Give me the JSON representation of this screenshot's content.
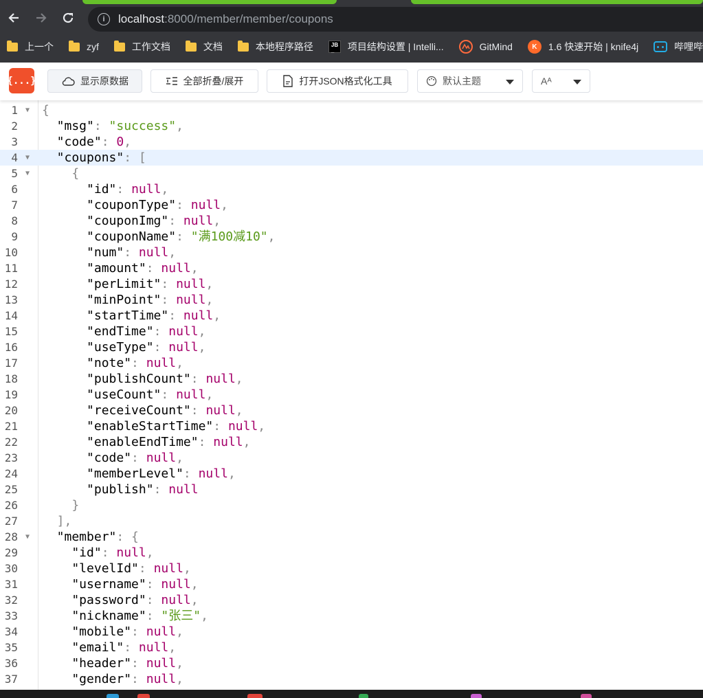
{
  "browser": {
    "url_host": "localhost",
    "url_path": ":8000/member/member/coupons",
    "bookmarks": [
      {
        "label": "上一个",
        "icon": "folder-icon"
      },
      {
        "label": "zyf",
        "icon": "folder-icon"
      },
      {
        "label": "工作文档",
        "icon": "folder-icon"
      },
      {
        "label": "文档",
        "icon": "folder-icon"
      },
      {
        "label": "本地程序路径",
        "icon": "folder-icon"
      },
      {
        "label": "项目结构设置 | Intelli...",
        "icon": "jetbrains-icon"
      },
      {
        "label": "GitMind",
        "icon": "gitmind-icon"
      },
      {
        "label": "1.6 快速开始 | knife4j",
        "icon": "knife4j-icon"
      },
      {
        "label": "哔哩哔",
        "icon": "bilibili-icon"
      }
    ]
  },
  "toolbar": {
    "logo_text": "{...}",
    "raw_label": "显示原数据",
    "fold_label": "全部折叠/展开",
    "format_label": "打开JSON格式化工具",
    "theme_label": "默认主题",
    "font_label": "Aᴬ"
  },
  "code_lines": [
    [
      [
        "p",
        "{"
      ]
    ],
    [
      [
        "k",
        "  \"msg\""
      ],
      [
        "p",
        ": "
      ],
      [
        "s",
        "\"success\""
      ],
      [
        "p",
        ","
      ]
    ],
    [
      [
        "k",
        "  \"code\""
      ],
      [
        "p",
        ": "
      ],
      [
        "n",
        "0"
      ],
      [
        "p",
        ","
      ]
    ],
    [
      [
        "k",
        "  \"coupons\""
      ],
      [
        "p",
        ": ["
      ]
    ],
    [
      [
        "p",
        "    {"
      ]
    ],
    [
      [
        "k",
        "      \"id\""
      ],
      [
        "p",
        ": "
      ],
      [
        "n",
        "null"
      ],
      [
        "p",
        ","
      ]
    ],
    [
      [
        "k",
        "      \"couponType\""
      ],
      [
        "p",
        ": "
      ],
      [
        "n",
        "null"
      ],
      [
        "p",
        ","
      ]
    ],
    [
      [
        "k",
        "      \"couponImg\""
      ],
      [
        "p",
        ": "
      ],
      [
        "n",
        "null"
      ],
      [
        "p",
        ","
      ]
    ],
    [
      [
        "k",
        "      \"couponName\""
      ],
      [
        "p",
        ": "
      ],
      [
        "s",
        "\"满100减10\""
      ],
      [
        "p",
        ","
      ]
    ],
    [
      [
        "k",
        "      \"num\""
      ],
      [
        "p",
        ": "
      ],
      [
        "n",
        "null"
      ],
      [
        "p",
        ","
      ]
    ],
    [
      [
        "k",
        "      \"amount\""
      ],
      [
        "p",
        ": "
      ],
      [
        "n",
        "null"
      ],
      [
        "p",
        ","
      ]
    ],
    [
      [
        "k",
        "      \"perLimit\""
      ],
      [
        "p",
        ": "
      ],
      [
        "n",
        "null"
      ],
      [
        "p",
        ","
      ]
    ],
    [
      [
        "k",
        "      \"minPoint\""
      ],
      [
        "p",
        ": "
      ],
      [
        "n",
        "null"
      ],
      [
        "p",
        ","
      ]
    ],
    [
      [
        "k",
        "      \"startTime\""
      ],
      [
        "p",
        ": "
      ],
      [
        "n",
        "null"
      ],
      [
        "p",
        ","
      ]
    ],
    [
      [
        "k",
        "      \"endTime\""
      ],
      [
        "p",
        ": "
      ],
      [
        "n",
        "null"
      ],
      [
        "p",
        ","
      ]
    ],
    [
      [
        "k",
        "      \"useType\""
      ],
      [
        "p",
        ": "
      ],
      [
        "n",
        "null"
      ],
      [
        "p",
        ","
      ]
    ],
    [
      [
        "k",
        "      \"note\""
      ],
      [
        "p",
        ": "
      ],
      [
        "n",
        "null"
      ],
      [
        "p",
        ","
      ]
    ],
    [
      [
        "k",
        "      \"publishCount\""
      ],
      [
        "p",
        ": "
      ],
      [
        "n",
        "null"
      ],
      [
        "p",
        ","
      ]
    ],
    [
      [
        "k",
        "      \"useCount\""
      ],
      [
        "p",
        ": "
      ],
      [
        "n",
        "null"
      ],
      [
        "p",
        ","
      ]
    ],
    [
      [
        "k",
        "      \"receiveCount\""
      ],
      [
        "p",
        ": "
      ],
      [
        "n",
        "null"
      ],
      [
        "p",
        ","
      ]
    ],
    [
      [
        "k",
        "      \"enableStartTime\""
      ],
      [
        "p",
        ": "
      ],
      [
        "n",
        "null"
      ],
      [
        "p",
        ","
      ]
    ],
    [
      [
        "k",
        "      \"enableEndTime\""
      ],
      [
        "p",
        ": "
      ],
      [
        "n",
        "null"
      ],
      [
        "p",
        ","
      ]
    ],
    [
      [
        "k",
        "      \"code\""
      ],
      [
        "p",
        ": "
      ],
      [
        "n",
        "null"
      ],
      [
        "p",
        ","
      ]
    ],
    [
      [
        "k",
        "      \"memberLevel\""
      ],
      [
        "p",
        ": "
      ],
      [
        "n",
        "null"
      ],
      [
        "p",
        ","
      ]
    ],
    [
      [
        "k",
        "      \"publish\""
      ],
      [
        "p",
        ": "
      ],
      [
        "n",
        "null"
      ]
    ],
    [
      [
        "p",
        "    }"
      ]
    ],
    [
      [
        "p",
        "  ],"
      ]
    ],
    [
      [
        "k",
        "  \"member\""
      ],
      [
        "p",
        ": {"
      ]
    ],
    [
      [
        "k",
        "    \"id\""
      ],
      [
        "p",
        ": "
      ],
      [
        "n",
        "null"
      ],
      [
        "p",
        ","
      ]
    ],
    [
      [
        "k",
        "    \"levelId\""
      ],
      [
        "p",
        ": "
      ],
      [
        "n",
        "null"
      ],
      [
        "p",
        ","
      ]
    ],
    [
      [
        "k",
        "    \"username\""
      ],
      [
        "p",
        ": "
      ],
      [
        "n",
        "null"
      ],
      [
        "p",
        ","
      ]
    ],
    [
      [
        "k",
        "    \"password\""
      ],
      [
        "p",
        ": "
      ],
      [
        "n",
        "null"
      ],
      [
        "p",
        ","
      ]
    ],
    [
      [
        "k",
        "    \"nickname\""
      ],
      [
        "p",
        ": "
      ],
      [
        "s",
        "\"张三\""
      ],
      [
        "p",
        ","
      ]
    ],
    [
      [
        "k",
        "    \"mobile\""
      ],
      [
        "p",
        ": "
      ],
      [
        "n",
        "null"
      ],
      [
        "p",
        ","
      ]
    ],
    [
      [
        "k",
        "    \"email\""
      ],
      [
        "p",
        ": "
      ],
      [
        "n",
        "null"
      ],
      [
        "p",
        ","
      ]
    ],
    [
      [
        "k",
        "    \"header\""
      ],
      [
        "p",
        ": "
      ],
      [
        "n",
        "null"
      ],
      [
        "p",
        ","
      ]
    ],
    [
      [
        "k",
        "    \"gender\""
      ],
      [
        "p",
        ": "
      ],
      [
        "n",
        "null"
      ],
      [
        "p",
        ","
      ]
    ]
  ],
  "fold_lines": [
    1,
    4,
    5,
    28
  ],
  "highlight_line": 4,
  "colors": {
    "key": "#000000",
    "punct": "#888888",
    "string": "#5a9a1a",
    "literal": "#a4006a",
    "logo": "#f0502b",
    "highlight": "#e8f2ff"
  }
}
